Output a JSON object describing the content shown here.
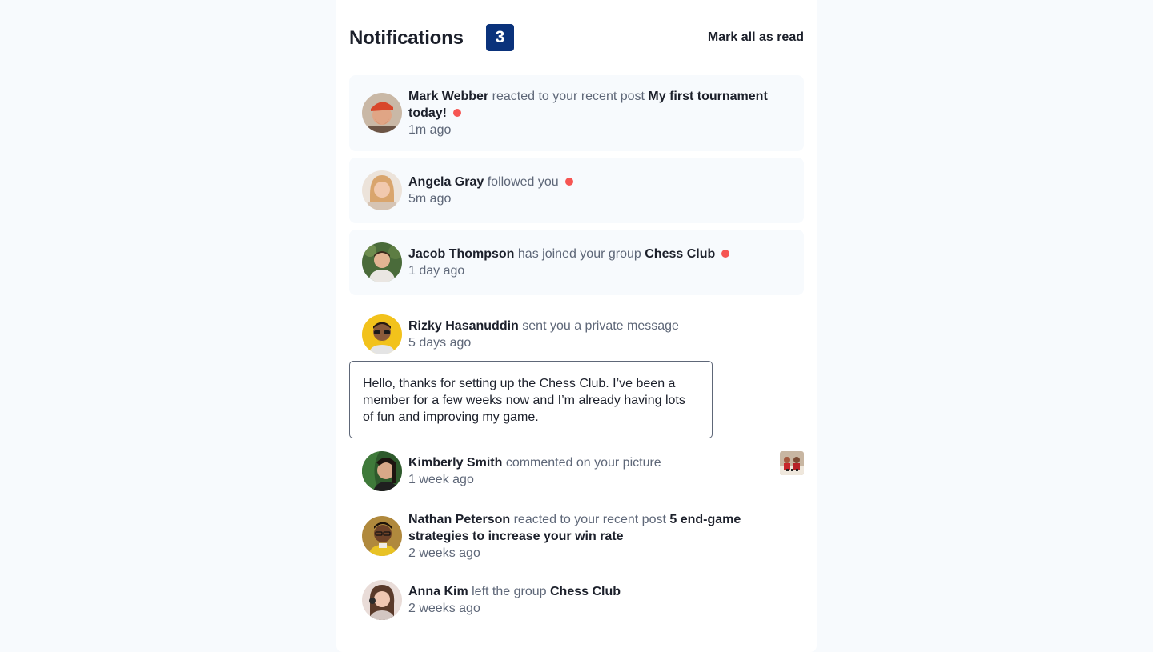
{
  "header": {
    "title": "Notifications",
    "unread_count": "3",
    "mark_all": "Mark all as read"
  },
  "notifications": [
    {
      "name": "Mark Webber",
      "action": "reacted to your recent post",
      "target_line1": "My first tournament",
      "target_line2": "today!",
      "time": "1m ago",
      "unread": true
    },
    {
      "name": "Angela Gray",
      "action": "followed you",
      "time": "5m ago",
      "unread": true
    },
    {
      "name": "Jacob Thompson",
      "action": "has joined your group",
      "target": "Chess Club",
      "time": "1 day ago",
      "unread": true
    },
    {
      "name": "Rizky Hasanuddin",
      "action": "sent you a private message",
      "time": "5 days ago",
      "message": "Hello, thanks for setting up the Chess Club. I’ve been a member for a few weeks now and I’m already having lots of fun and improving my game.",
      "unread": false
    },
    {
      "name": "Kimberly Smith",
      "action": "commented on your picture",
      "time": "1 week ago",
      "unread": false
    },
    {
      "name": "Nathan Peterson",
      "action": "reacted to your recent post",
      "target_line1": "5 end-game",
      "target_line2": "strategies to increase your win rate",
      "time": "2 weeks ago",
      "unread": false
    },
    {
      "name": "Anna Kim",
      "action": "left the group",
      "target": "Chess Club",
      "time": "2 weeks ago",
      "unread": false
    }
  ],
  "colors": {
    "page_background": "#f7fafd",
    "unread_background": "#f7fafd",
    "badge": "#0a327b",
    "unread_dot": "#f65552",
    "text_dark": "#1c202b",
    "text_muted": "#5e6778"
  }
}
